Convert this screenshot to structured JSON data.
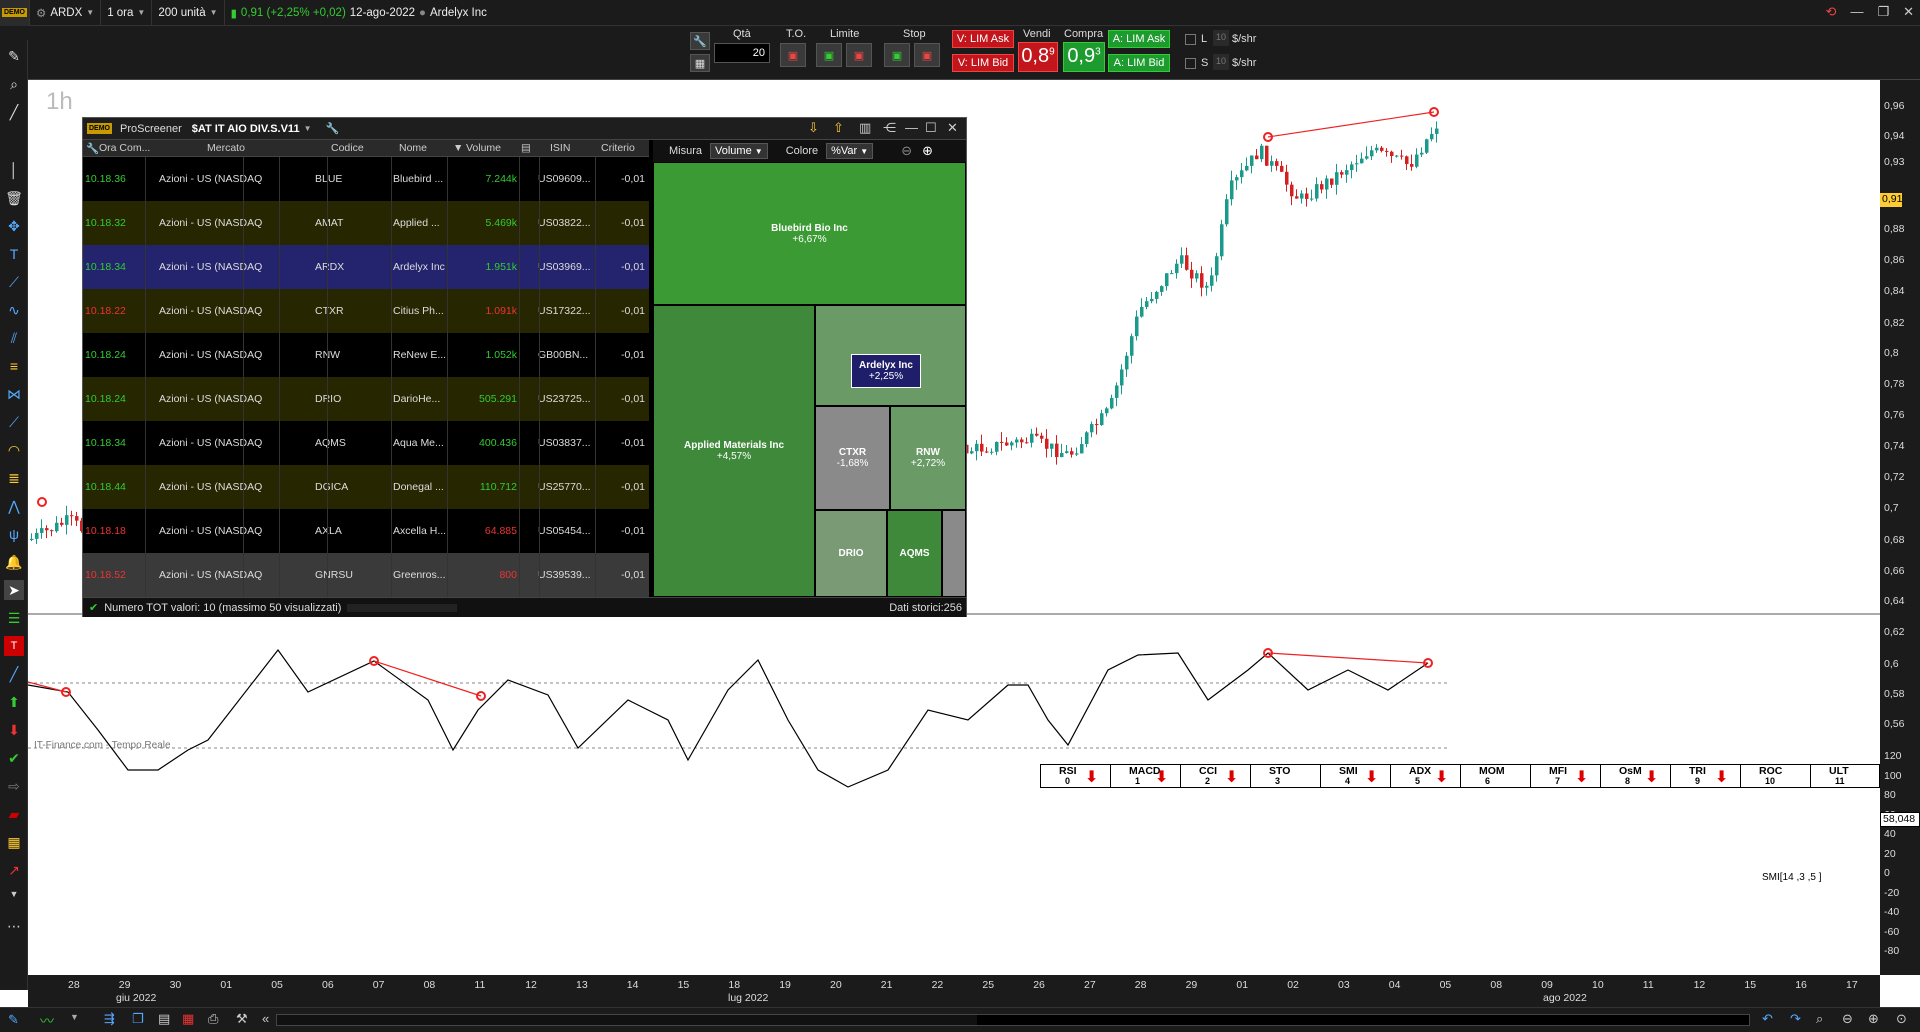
{
  "topbar": {
    "ticker": "ARDX",
    "timeframe": "1 ora",
    "units": "200 unità",
    "price_info": "0,91 (+2,25% +0,02)",
    "date": "12-ago-2022",
    "company": "Ardelyx Inc"
  },
  "orderbar": {
    "qta_label": "Qtà",
    "qta_value": "20",
    "to_label": "T.O.",
    "limite_label": "Limite",
    "stop_label": "Stop",
    "v_lim_ask": "V: LIM Ask",
    "v_lim_bid": "V: LIM Bid",
    "vendi_label": "Vendi",
    "vendi_price": "0,8",
    "vendi_sup": "9",
    "compra_label": "Compra",
    "compra_price": "0,9",
    "compra_sup": "3",
    "a_lim_ask": "A: LIM Ask",
    "a_lim_bid": "A: LIM Bid",
    "l_label": "L",
    "s_label": "S",
    "l_qty": "10",
    "s_qty": "10",
    "shr1": "$/shr",
    "shr2": "$/shr"
  },
  "chart": {
    "timeframe_label": "1h",
    "credit": "IT-Finance.com - Tempo Reale",
    "indicator_label": "SMI[14 ,3 ,5 ]",
    "osc_value": "58,048",
    "price_axis": [
      "0,96",
      "0,94",
      "0,93",
      "0,91",
      "0,9",
      "0,88",
      "0,86",
      "0,84",
      "0,82",
      "0,8",
      "0,78",
      "0,76",
      "0,74",
      "0,72",
      "0,7",
      "0,68",
      "0,66",
      "0,64",
      "0,62",
      "0,6",
      "0,58",
      "0,56"
    ],
    "osc_axis": [
      "120",
      "100",
      "80",
      "60",
      "40",
      "20",
      "0",
      "-20",
      "-40",
      "-60",
      "-80"
    ],
    "date_labels": [
      "28",
      "29",
      "30",
      "01",
      "05",
      "06",
      "07",
      "08",
      "11",
      "12",
      "13",
      "14",
      "15",
      "18",
      "19",
      "20",
      "21",
      "22",
      "25",
      "26",
      "27",
      "28",
      "29",
      "01",
      "02",
      "03",
      "04",
      "05",
      "08",
      "09",
      "10",
      "11",
      "12",
      "15",
      "16",
      "17"
    ],
    "month_labels": [
      "giu 2022",
      "lug 2022",
      "ago 2022"
    ]
  },
  "signals": [
    {
      "name": "RSI",
      "num": "0",
      "arrow": true
    },
    {
      "name": "MACD",
      "num": "1",
      "arrow": true
    },
    {
      "name": "CCI",
      "num": "2",
      "arrow": true
    },
    {
      "name": "STO",
      "num": "3",
      "arrow": false
    },
    {
      "name": "SMI",
      "num": "4",
      "arrow": true
    },
    {
      "name": "ADX",
      "num": "5",
      "arrow": true
    },
    {
      "name": "MOM",
      "num": "6",
      "arrow": false
    },
    {
      "name": "MFI",
      "num": "7",
      "arrow": true
    },
    {
      "name": "OsM",
      "num": "8",
      "arrow": true
    },
    {
      "name": "TRI",
      "num": "9",
      "arrow": true
    },
    {
      "name": "ROC",
      "num": "10",
      "arrow": false
    },
    {
      "name": "ULT",
      "num": "11",
      "arrow": false
    }
  ],
  "screener": {
    "title": "ProScreener",
    "list_name": "$AT IT AIO DIV.S.V11",
    "headers": {
      "time": "Ora Com...",
      "market": "Mercato",
      "code": "Codice",
      "name": "Nome",
      "volume": "Volume",
      "isin": "ISIN",
      "criterio": "Criterio"
    },
    "rows": [
      {
        "time": "10.18.36",
        "market": "Azioni - US (NASDAQ",
        "code": "BLUE",
        "name": "Bluebird ...",
        "volume": "7.244k",
        "isin": "US09609...",
        "crit": "-0,01",
        "tcolor": "#3c3",
        "vcolor": "#3c3",
        "bg": "#000"
      },
      {
        "time": "10.18.32",
        "market": "Azioni - US (NASDAQ",
        "code": "AMAT",
        "name": "Applied ...",
        "volume": "5.469k",
        "isin": "US03822...",
        "crit": "-0,01",
        "tcolor": "#3c3",
        "vcolor": "#3c3",
        "bg": "#262600"
      },
      {
        "time": "10.18.34",
        "market": "Azioni - US (NASDAQ",
        "code": "ARDX",
        "name": "Ardelyx Inc",
        "volume": "1.951k",
        "isin": "US03969...",
        "crit": "-0,01",
        "tcolor": "#3c3",
        "vcolor": "#3c3",
        "bg": "#23236e"
      },
      {
        "time": "10.18.22",
        "market": "Azioni - US (NASDAQ",
        "code": "CTXR",
        "name": "Citius Ph...",
        "volume": "1.091k",
        "isin": "US17322...",
        "crit": "-0,01",
        "tcolor": "#e33",
        "vcolor": "#e33",
        "bg": "#262600"
      },
      {
        "time": "10.18.24",
        "market": "Azioni - US (NASDAQ",
        "code": "RNW",
        "name": "ReNew E...",
        "volume": "1.052k",
        "isin": "GB00BN...",
        "crit": "-0,01",
        "tcolor": "#3c3",
        "vcolor": "#3c3",
        "bg": "#000"
      },
      {
        "time": "10.18.24",
        "market": "Azioni - US (NASDAQ",
        "code": "DRIO",
        "name": "DarioHe...",
        "volume": "505.291",
        "isin": "US23725...",
        "crit": "-0,01",
        "tcolor": "#3c3",
        "vcolor": "#3c3",
        "bg": "#262600"
      },
      {
        "time": "10.18.34",
        "market": "Azioni - US (NASDAQ",
        "code": "AQMS",
        "name": "Aqua Me...",
        "volume": "400.436",
        "isin": "US03837...",
        "crit": "-0,01",
        "tcolor": "#3c3",
        "vcolor": "#3c3",
        "bg": "#000"
      },
      {
        "time": "10.18.44",
        "market": "Azioni - US (NASDAQ",
        "code": "DGICA",
        "name": "Donegal ...",
        "volume": "110.712",
        "isin": "US25770...",
        "crit": "-0,01",
        "tcolor": "#3c3",
        "vcolor": "#3c3",
        "bg": "#262600"
      },
      {
        "time": "10.18.18",
        "market": "Azioni - US (NASDAQ",
        "code": "AXLA",
        "name": "Axcella H...",
        "volume": "64.885",
        "isin": "US05454...",
        "crit": "-0,01",
        "tcolor": "#e33",
        "vcolor": "#e33",
        "bg": "#000"
      },
      {
        "time": "10.18.52",
        "market": "Azioni - US (NASDAQ",
        "code": "GNRSU",
        "name": "Greenros...",
        "volume": "800",
        "isin": "US39539...",
        "crit": "-0,01",
        "tcolor": "#e33",
        "vcolor": "#e33",
        "bg": "#3a3a3a"
      }
    ],
    "treemap": {
      "misura_label": "Misura",
      "misura_value": "Volume",
      "colore_label": "Colore",
      "colore_value": "%Var",
      "tiles": {
        "blue": {
          "name": "Bluebird Bio Inc",
          "pct": "+6,67%"
        },
        "amat": {
          "name": "Applied Materials Inc",
          "pct": "+4,57%"
        },
        "ardx": {
          "name": "Ardelyx Inc",
          "pct": "+2,25%"
        },
        "ctxr": {
          "name": "CTXR",
          "pct": "-1,68%"
        },
        "rnw": {
          "name": "RNW",
          "pct": "+2,72%"
        },
        "drio": {
          "name": "DRIO"
        },
        "aqms": {
          "name": "AQMS"
        }
      }
    },
    "status": "Numero TOT valori: 10 (massimo 50 visualizzati)",
    "storici": "Dati storici:256"
  }
}
